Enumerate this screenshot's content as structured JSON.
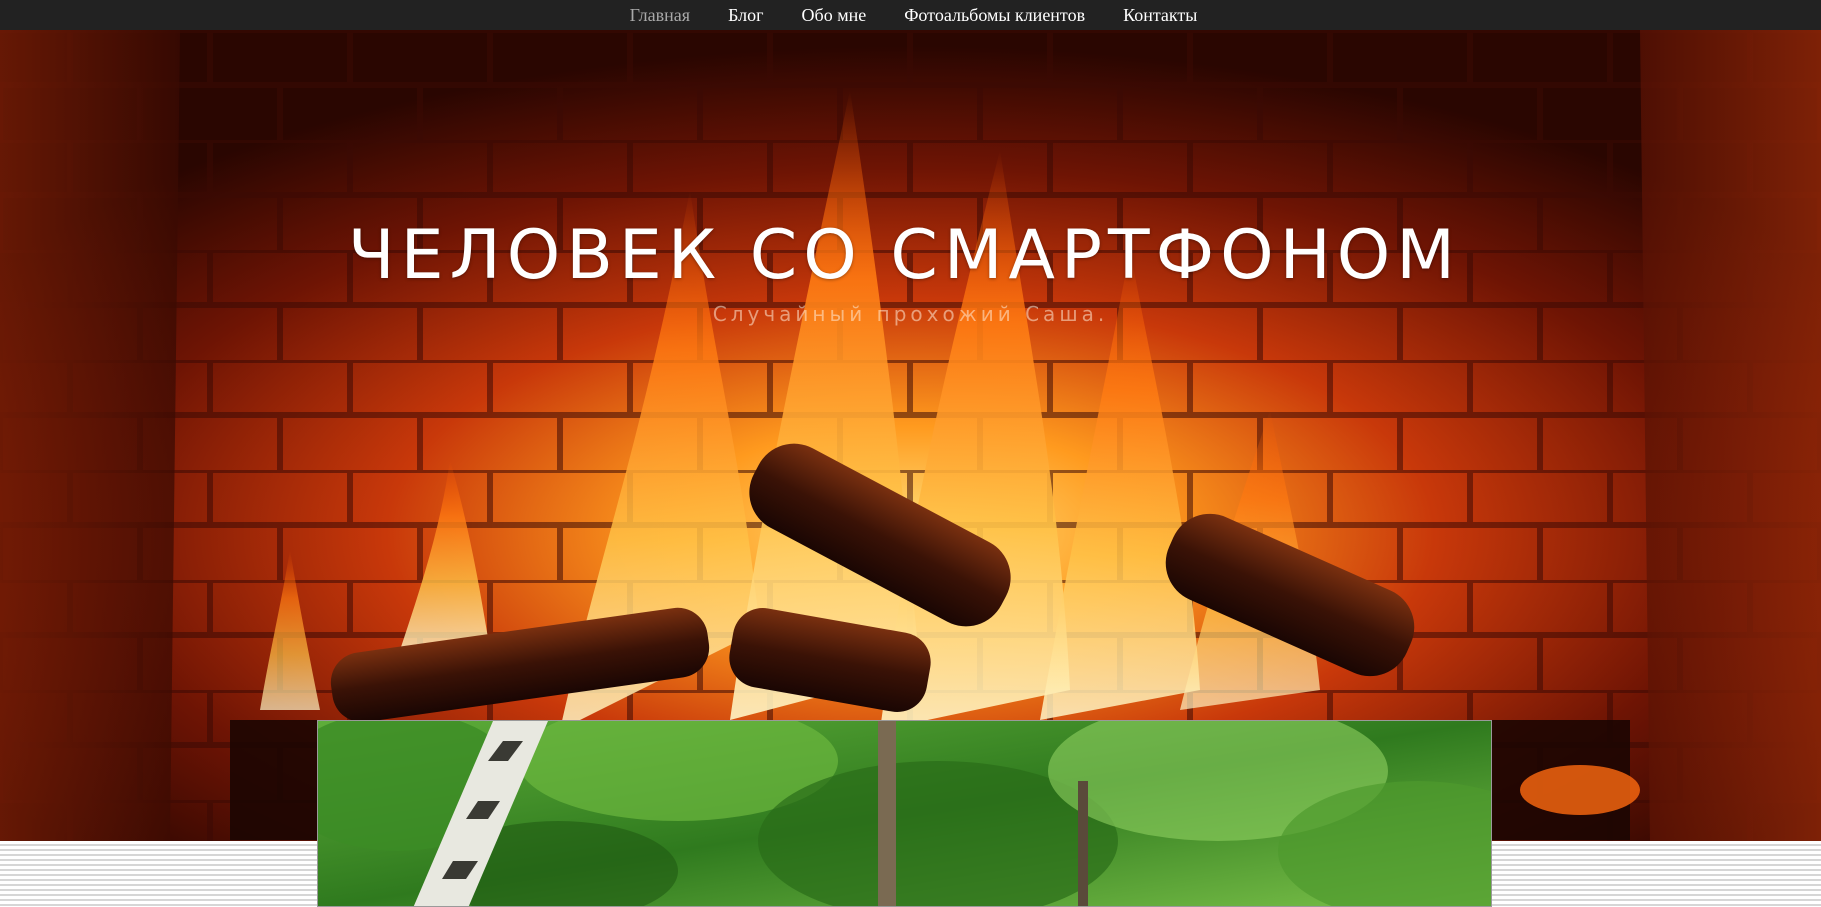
{
  "nav": {
    "items": [
      {
        "label": "Главная",
        "active": true
      },
      {
        "label": "Блог",
        "active": false
      },
      {
        "label": "Обо мне",
        "active": false
      },
      {
        "label": "Фотоальбомы клиентов",
        "active": false
      },
      {
        "label": "Контакты",
        "active": false
      }
    ]
  },
  "hero": {
    "title": "ЧЕЛОВЕК СО СМАРТФОНОМ",
    "subtitle": "Случайный прохожий Саша."
  },
  "colors": {
    "nav_background": "#222222",
    "nav_active_text": "#a9a9a9",
    "nav_text": "#ffffff",
    "title_text": "#ffffff"
  }
}
